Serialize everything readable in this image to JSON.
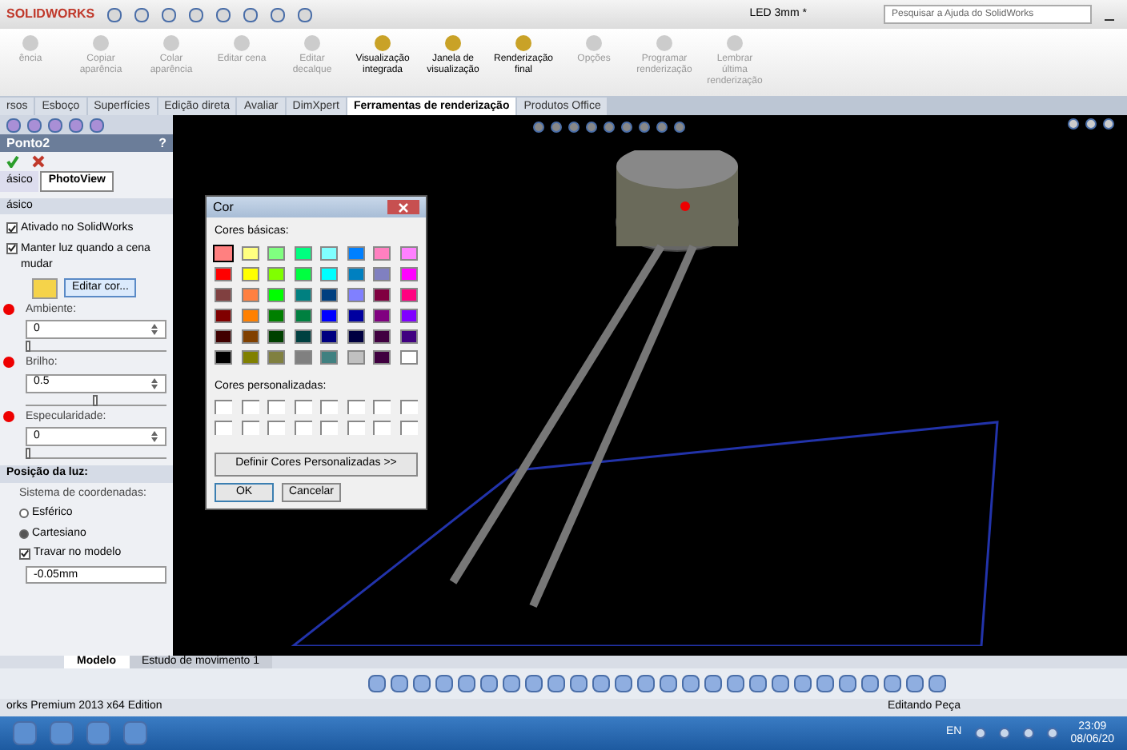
{
  "title_bar": {
    "logo": "SOLIDWORKS",
    "title": "LED 3mm *",
    "search": {
      "placeholder": "Pesquisar a Ajuda do SolidWorks"
    }
  },
  "ribbon": [
    {
      "label": "ência",
      "disabled": true
    },
    {
      "label": "Copiar aparência",
      "disabled": true
    },
    {
      "label": "Colar aparência",
      "disabled": true
    },
    {
      "label": "Editar cena",
      "disabled": true
    },
    {
      "label": "Editar decalque",
      "disabled": true
    },
    {
      "label": "Visualização integrada",
      "disabled": false
    },
    {
      "label": "Janela de visualização",
      "disabled": false
    },
    {
      "label": "Renderização final",
      "disabled": false
    },
    {
      "label": "Opções",
      "disabled": true
    },
    {
      "label": "Programar renderização",
      "disabled": true
    },
    {
      "label": "Lembrar última renderização",
      "disabled": true
    }
  ],
  "tabs": [
    {
      "label": "rsos",
      "selected": false
    },
    {
      "label": "Esboço",
      "selected": false
    },
    {
      "label": "Superfícies",
      "selected": false
    },
    {
      "label": "Edição direta",
      "selected": false
    },
    {
      "label": "Avaliar",
      "selected": false
    },
    {
      "label": "DimXpert",
      "selected": false
    },
    {
      "label": "Ferramentas de renderização",
      "selected": true
    },
    {
      "label": "Produtos Office",
      "selected": false
    }
  ],
  "property_panel": {
    "title": "Ponto2",
    "help": "?",
    "tabs": [
      {
        "label": "ásico",
        "selected": false
      },
      {
        "label": "PhotoView",
        "selected": true
      }
    ],
    "basic_section": {
      "title": "ásico",
      "checks": [
        {
          "label": "Ativado no SolidWorks",
          "checked": true
        },
        {
          "label": "Manter luz quando a cena mudar",
          "checked": true
        }
      ],
      "edit_color": "Editar cor...",
      "fields": [
        {
          "label": "Ambiente:",
          "value": "0",
          "level": 0
        },
        {
          "label": "Brilho:",
          "value": "0.5",
          "level": 0.5
        },
        {
          "label": "Especularidade:",
          "value": "0",
          "level": 0
        }
      ]
    },
    "position_section": {
      "title": "Posição da luz:",
      "coord_label": "Sistema de coordenadas:",
      "radios": [
        {
          "label": "Esférico",
          "selected": false
        },
        {
          "label": "Cartesiano",
          "selected": true
        }
      ],
      "lock": {
        "label": "Travar no modelo",
        "checked": true
      },
      "value": "-0.05mm"
    }
  },
  "color_dialog": {
    "title": "Cor",
    "basic_label": "Cores básicas:",
    "colors": [
      {
        "color": "#ff8080",
        "selected": true
      },
      {
        "color": "#ffff80",
        "selected": false
      },
      {
        "color": "#80ff80",
        "selected": false
      },
      {
        "color": "#00ff80",
        "selected": false
      },
      {
        "color": "#80ffff",
        "selected": false
      },
      {
        "color": "#0080ff",
        "selected": false
      },
      {
        "color": "#ff80c0",
        "selected": false
      },
      {
        "color": "#ff80ff",
        "selected": false
      },
      {
        "color": "#ff0000",
        "selected": false
      },
      {
        "color": "#ffff00",
        "selected": false
      },
      {
        "color": "#80ff00",
        "selected": false
      },
      {
        "color": "#00ff40",
        "selected": false
      },
      {
        "color": "#00ffff",
        "selected": false
      },
      {
        "color": "#0080c0",
        "selected": false
      },
      {
        "color": "#8080c0",
        "selected": false
      },
      {
        "color": "#ff00ff",
        "selected": false
      },
      {
        "color": "#804040",
        "selected": false
      },
      {
        "color": "#ff8040",
        "selected": false
      },
      {
        "color": "#00ff00",
        "selected": false
      },
      {
        "color": "#008080",
        "selected": false
      },
      {
        "color": "#004080",
        "selected": false
      },
      {
        "color": "#8080ff",
        "selected": false
      },
      {
        "color": "#800040",
        "selected": false
      },
      {
        "color": "#ff0080",
        "selected": false
      },
      {
        "color": "#800000",
        "selected": false
      },
      {
        "color": "#ff8000",
        "selected": false
      },
      {
        "color": "#008000",
        "selected": false
      },
      {
        "color": "#008040",
        "selected": false
      },
      {
        "color": "#0000ff",
        "selected": false
      },
      {
        "color": "#0000a0",
        "selected": false
      },
      {
        "color": "#800080",
        "selected": false
      },
      {
        "color": "#8000ff",
        "selected": false
      },
      {
        "color": "#400000",
        "selected": false
      },
      {
        "color": "#804000",
        "selected": false
      },
      {
        "color": "#004000",
        "selected": false
      },
      {
        "color": "#004040",
        "selected": false
      },
      {
        "color": "#000080",
        "selected": false
      },
      {
        "color": "#000040",
        "selected": false
      },
      {
        "color": "#400040",
        "selected": false
      },
      {
        "color": "#400080",
        "selected": false
      },
      {
        "color": "#000000",
        "selected": false
      },
      {
        "color": "#808000",
        "selected": false
      },
      {
        "color": "#808040",
        "selected": false
      },
      {
        "color": "#808080",
        "selected": false
      },
      {
        "color": "#408080",
        "selected": false
      },
      {
        "color": "#c0c0c0",
        "selected": false
      },
      {
        "color": "#400040",
        "selected": false
      },
      {
        "color": "#ffffff",
        "selected": false
      }
    ],
    "custom_label": "Cores personalizadas:",
    "define_button": "Definir Cores Personalizadas >>",
    "ok": "OK",
    "cancel": "Cancelar"
  },
  "bottom_tabs": [
    {
      "label": "Modelo",
      "selected": true
    },
    {
      "label": "Estudo de movimento 1",
      "selected": false
    }
  ],
  "status_bar": {
    "left": "orks Premium 2013 x64 Edition",
    "right": "Editando Peça"
  },
  "taskbar": {
    "language": "EN",
    "time": "23:09",
    "date": "08/06/20"
  }
}
